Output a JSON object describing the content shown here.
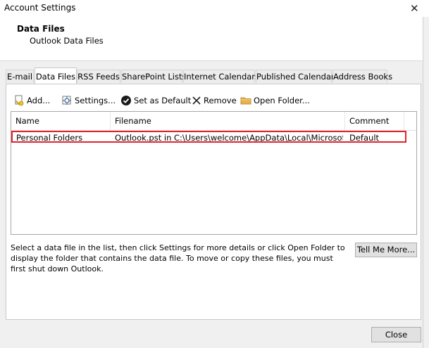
{
  "window": {
    "title": "Account Settings",
    "close_glyph": "✕"
  },
  "header": {
    "title": "Data Files",
    "subtitle": "Outlook Data Files"
  },
  "tabs": [
    {
      "label": "E-mail"
    },
    {
      "label": "Data Files",
      "active": true
    },
    {
      "label": "RSS Feeds"
    },
    {
      "label": "SharePoint Lists"
    },
    {
      "label": "Internet Calendars"
    },
    {
      "label": "Published Calendars"
    },
    {
      "label": "Address Books"
    }
  ],
  "toolbar": {
    "add": {
      "label": "Add...",
      "icon": "add-file-icon"
    },
    "settings": {
      "label": "Settings...",
      "icon": "settings-icon"
    },
    "set_default": {
      "label": "Set as Default",
      "icon": "check-circle-icon"
    },
    "remove": {
      "label": "Remove",
      "icon": "remove-x-icon"
    },
    "open_folder": {
      "label": "Open Folder...",
      "icon": "folder-icon"
    }
  },
  "list": {
    "columns": [
      "Name",
      "Filename",
      "Comment"
    ],
    "rows": [
      {
        "name": "Personal Folders",
        "filename": "Outlook.pst in C:\\Users\\welcome\\AppData\\Local\\Microsoft\\Outlook",
        "comment": "Default"
      }
    ]
  },
  "description": "Select a data file in the list, then click Settings for more details or click Open Folder to display the folder that contains the data file. To move or copy these files, you must first shut down Outlook.",
  "buttons": {
    "tell_me_more": "Tell Me More...",
    "close": "Close"
  },
  "colors": {
    "highlight": "#e0242b",
    "check": "#1a1a1a",
    "folder": "#e8b34a"
  }
}
